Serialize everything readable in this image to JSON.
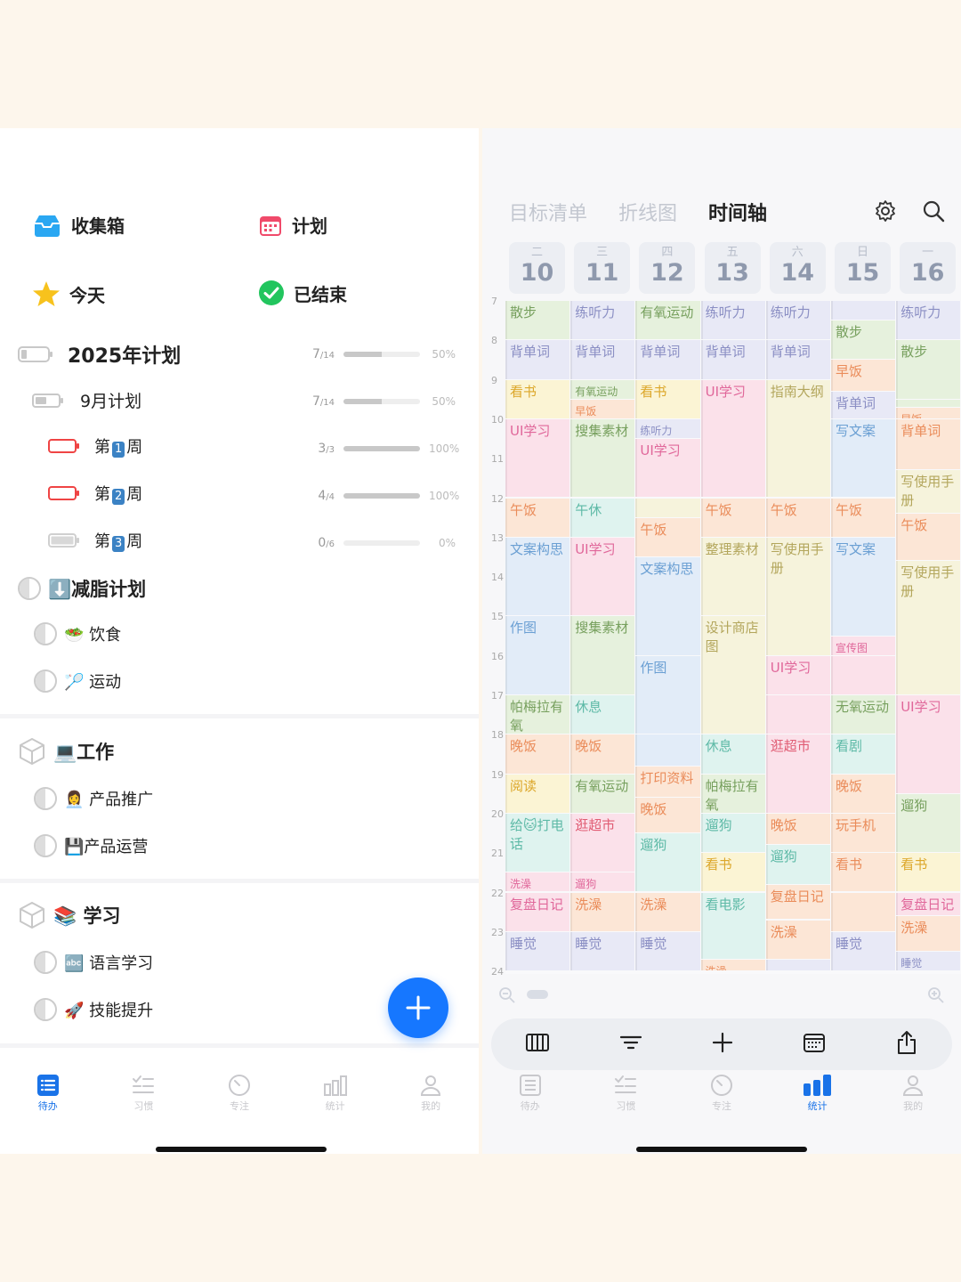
{
  "left": {
    "tiles": [
      {
        "label": "收集箱",
        "icon": "inbox-icon"
      },
      {
        "label": "计划",
        "icon": "calendar-icon"
      },
      {
        "label": "今天",
        "icon": "star-icon"
      },
      {
        "label": "已结束",
        "icon": "check-circle-icon"
      }
    ],
    "plans": [
      {
        "name": "2025年计划",
        "done": "7",
        "total": "/14",
        "progress": 0.5,
        "pct": "50%"
      },
      {
        "name": "9月计划",
        "done": "7",
        "total": "/14",
        "progress": 0.5,
        "pct": "50%"
      },
      {
        "pre": "第",
        "num": "1",
        "post": "周",
        "done": "3",
        "total": "/3",
        "progress": 1,
        "pct": "100%"
      },
      {
        "pre": "第",
        "num": "2",
        "post": "周",
        "done": "4",
        "total": "/4",
        "progress": 1,
        "pct": "100%"
      },
      {
        "pre": "第",
        "num": "3",
        "post": "周",
        "done": "0",
        "total": "/6",
        "progress": 0,
        "pct": "0%"
      }
    ],
    "groups": [
      {
        "title": "⬇️减脂计划",
        "items": [
          "🥗 饮食",
          "🏸 运动"
        ]
      },
      {
        "title": "💻工作",
        "items": [
          "👩‍💼 产品推广",
          "💾产品运营"
        ]
      },
      {
        "title": "📚 学习",
        "items": [
          "🔤 语言学习",
          "🚀 技能提升"
        ]
      }
    ]
  },
  "tabs": [
    "待办",
    "习惯",
    "专注",
    "统计",
    "我的"
  ],
  "right": {
    "views": [
      "目标清单",
      "折线图",
      "时间轴"
    ],
    "days": [
      {
        "wd": "二",
        "d": "10"
      },
      {
        "wd": "三",
        "d": "11"
      },
      {
        "wd": "四",
        "d": "12"
      },
      {
        "wd": "五",
        "d": "13"
      },
      {
        "wd": "六",
        "d": "14"
      },
      {
        "wd": "日",
        "d": "15"
      },
      {
        "wd": "一",
        "d": "16"
      }
    ],
    "hours": [
      "7",
      "8",
      "9",
      "10",
      "11",
      "12",
      "13",
      "14",
      "15",
      "16",
      "17",
      "18",
      "19",
      "20",
      "21",
      "22",
      "23",
      "24"
    ],
    "colors": {
      "g": "#e6f1dd",
      "p": "#e8e9f6",
      "y": "#fbf4d4",
      "k": "#fbe1ea",
      "o": "#fce6d6",
      "b": "#e2ecf8",
      "t": "#dff3ef",
      "h": "#f6f3dc"
    },
    "textColors": {
      "g": "#77a05e",
      "p": "#8b8fc4",
      "y": "#dca72a",
      "k": "#e0679a",
      "o": "#ea8c5a",
      "b": "#6a9fd3",
      "t": "#5db9a6",
      "h": "#b3a65c",
      "r": "#e05c73"
    },
    "events": [
      [
        [
          7,
          8,
          "g",
          "散步"
        ],
        [
          8,
          9,
          "p",
          "背单词"
        ],
        [
          9,
          10,
          "y",
          "看书"
        ],
        [
          10,
          12,
          "k",
          "UI学习"
        ],
        [
          12,
          13,
          "o",
          "午饭"
        ],
        [
          13,
          15,
          "b",
          "文案构思"
        ],
        [
          15,
          17,
          "b",
          "作图"
        ],
        [
          17,
          18,
          "g",
          "帕梅拉有氧"
        ],
        [
          18,
          19,
          "o",
          "晚饭"
        ],
        [
          19,
          20,
          "y",
          "阅读"
        ],
        [
          20,
          21.5,
          "t",
          "给🐱打电话"
        ],
        [
          21.5,
          22,
          "k",
          "洗澡"
        ],
        [
          22,
          23,
          "k",
          "复盘日记"
        ],
        [
          23,
          24,
          "p",
          "睡觉"
        ]
      ],
      [
        [
          7,
          8,
          "p",
          "练听力"
        ],
        [
          8,
          9,
          "p",
          "背单词"
        ],
        [
          9,
          9.5,
          "g",
          "有氧运动"
        ],
        [
          9.5,
          10,
          "o",
          "早饭"
        ],
        [
          10,
          12,
          "g",
          "搜集素材"
        ],
        [
          12,
          13,
          "t",
          "午休"
        ],
        [
          13,
          15,
          "k",
          "UI学习"
        ],
        [
          15,
          17,
          "g",
          "搜集素材"
        ],
        [
          17,
          18,
          "t",
          "休息"
        ],
        [
          18,
          19,
          "o",
          "晚饭"
        ],
        [
          19,
          20,
          "g",
          "有氧运动"
        ],
        [
          20,
          21.5,
          "k",
          "逛超市"
        ],
        [
          21.5,
          22,
          "k",
          "遛狗"
        ],
        [
          22,
          23,
          "o",
          "洗澡"
        ],
        [
          23,
          24,
          "p",
          "睡觉"
        ]
      ],
      [
        [
          7,
          8,
          "g",
          "有氧运动"
        ],
        [
          8,
          9,
          "p",
          "背单词"
        ],
        [
          9,
          10,
          "y",
          "看书"
        ],
        [
          10,
          10.5,
          "p",
          "练听力"
        ],
        [
          10.5,
          12,
          "k",
          "UI学习"
        ],
        [
          12,
          12.5,
          "h",
          ""
        ],
        [
          12.5,
          13.5,
          "o",
          "午饭"
        ],
        [
          13.5,
          16,
          "b",
          "文案构思"
        ],
        [
          16,
          18,
          "b",
          "作图"
        ],
        [
          18,
          18.8,
          "b",
          ""
        ],
        [
          18.8,
          19.6,
          "o",
          "打印资料"
        ],
        [
          19.6,
          20.5,
          "o",
          "晚饭"
        ],
        [
          20.5,
          22,
          "t",
          "遛狗"
        ],
        [
          22,
          23,
          "o",
          "洗澡"
        ],
        [
          23,
          24,
          "p",
          "睡觉"
        ]
      ],
      [
        [
          7,
          8,
          "p",
          "练听力"
        ],
        [
          8,
          9,
          "p",
          "背单词"
        ],
        [
          9,
          12,
          "k",
          "UI学习"
        ],
        [
          12,
          13,
          "o",
          "午饭"
        ],
        [
          13,
          15,
          "h",
          "整理素材"
        ],
        [
          15,
          18,
          "h",
          "设计商店图"
        ],
        [
          18,
          19,
          "t",
          "休息"
        ],
        [
          19,
          20,
          "g",
          "帕梅拉有氧"
        ],
        [
          20,
          21,
          "t",
          "遛狗"
        ],
        [
          21,
          22,
          "y",
          "看书"
        ],
        [
          22,
          23.7,
          "t",
          "看电影"
        ],
        [
          23.7,
          24,
          "o",
          "洗澡"
        ]
      ],
      [
        [
          7,
          8,
          "p",
          "练听力"
        ],
        [
          8,
          9,
          "p",
          "背单词"
        ],
        [
          9,
          12,
          "h",
          "指南大纲"
        ],
        [
          12,
          13,
          "o",
          "午饭"
        ],
        [
          13,
          16,
          "h",
          "写使用手册"
        ],
        [
          16,
          17,
          "k",
          "UI学习"
        ],
        [
          17,
          18,
          "k",
          ""
        ],
        [
          18,
          20,
          "k",
          "逛超市"
        ],
        [
          20,
          20.8,
          "o",
          "晚饭"
        ],
        [
          20.8,
          21.8,
          "t",
          "遛狗"
        ],
        [
          21.8,
          22.7,
          "o",
          "复盘日记"
        ],
        [
          22.7,
          23.7,
          "o",
          "洗澡"
        ],
        [
          23.7,
          24,
          "p",
          ""
        ]
      ],
      [
        [
          7,
          7.5,
          "p",
          ""
        ],
        [
          7.5,
          8.5,
          "g",
          "散步"
        ],
        [
          8.5,
          9.3,
          "o",
          "早饭"
        ],
        [
          9.3,
          10,
          "p",
          "背单词"
        ],
        [
          10,
          12,
          "b",
          "写文案"
        ],
        [
          12,
          13,
          "o",
          "午饭"
        ],
        [
          13,
          15.5,
          "b",
          "写文案"
        ],
        [
          15.5,
          16,
          "k",
          "宣传图"
        ],
        [
          16,
          17,
          "k",
          ""
        ],
        [
          17,
          18,
          "g",
          "无氧运动"
        ],
        [
          18,
          19,
          "t",
          "看剧"
        ],
        [
          19,
          20,
          "o",
          "晚饭"
        ],
        [
          20,
          21,
          "o",
          "玩手机"
        ],
        [
          21,
          22,
          "o",
          "看书"
        ],
        [
          22,
          23,
          "o",
          ""
        ],
        [
          23,
          24,
          "p",
          "睡觉"
        ]
      ],
      [
        [
          7,
          8,
          "p",
          "练听力"
        ],
        [
          8,
          9.5,
          "g",
          "散步"
        ],
        [
          9.5,
          9.7,
          "g",
          ""
        ],
        [
          9.7,
          10,
          "o",
          "早饭"
        ],
        [
          10,
          11.3,
          "o",
          "背单词"
        ],
        [
          11.3,
          12.4,
          "h",
          "写使用手册"
        ],
        [
          12.4,
          13.6,
          "o",
          "午饭"
        ],
        [
          13.6,
          17,
          "h",
          "写使用手册"
        ],
        [
          17,
          19.5,
          "k",
          "UI学习"
        ],
        [
          19.5,
          21,
          "g",
          "遛狗"
        ],
        [
          21,
          22,
          "y",
          "看书"
        ],
        [
          22,
          22.6,
          "k",
          "复盘日记"
        ],
        [
          22.6,
          23.5,
          "o",
          "洗澡"
        ],
        [
          23.5,
          24,
          "p",
          "睡觉"
        ]
      ]
    ]
  }
}
